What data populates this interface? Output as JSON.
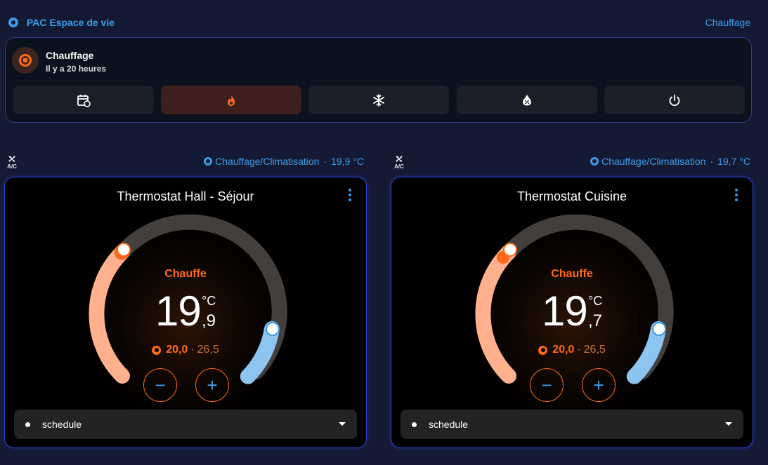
{
  "header": {
    "title": "PAC Espace de vie",
    "right_link": "Chauffage"
  },
  "mode_card": {
    "title": "Chauffage",
    "subtitle": "Il y a 20 heures",
    "buttons": [
      {
        "icon": "calendar-sync-icon",
        "active": false
      },
      {
        "icon": "fire-icon",
        "active": true
      },
      {
        "icon": "snowflake-icon",
        "active": false
      },
      {
        "icon": "water-percent-icon",
        "active": false
      },
      {
        "icon": "power-icon",
        "active": false
      }
    ]
  },
  "colors": {
    "accent_blue": "#3d9be9",
    "heat_orange": "#ff6a1a",
    "heat_arc": "#ffb08c",
    "cool_arc": "#8ec4f0"
  },
  "thermostats": [
    {
      "ac_icon_label": "A/C",
      "mode_label": "Chauffage/Climatisation",
      "separator": "·",
      "current_reading": "19,9 °C",
      "title": "Thermostat Hall - Séjour",
      "status": "Chauffe",
      "temp_int": "19",
      "temp_unit": "°C",
      "temp_dec": ",9",
      "low": "20,0",
      "range_sep": "·",
      "high": "26,5",
      "minus": "−",
      "plus": "+",
      "preset": "schedule"
    },
    {
      "ac_icon_label": "A/C",
      "mode_label": "Chauffage/Climatisation",
      "separator": "·",
      "current_reading": "19,7 °C",
      "title": "Thermostat Cuisine",
      "status": "Chauffe",
      "temp_int": "19",
      "temp_unit": "°C",
      "temp_dec": ",7",
      "low": "20,0",
      "range_sep": "·",
      "high": "26,5",
      "minus": "−",
      "plus": "+",
      "preset": "schedule"
    }
  ]
}
